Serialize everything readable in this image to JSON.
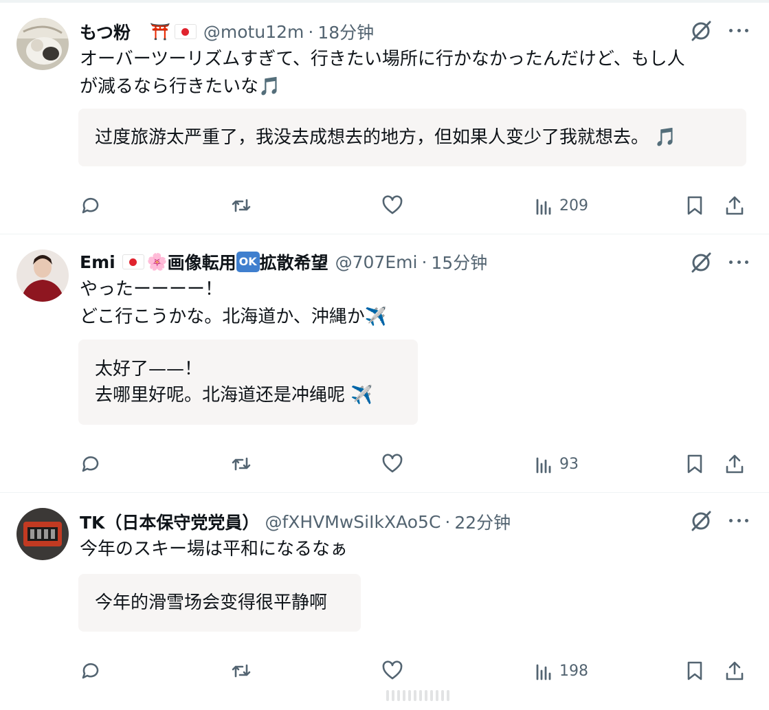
{
  "posts": [
    {
      "name": "もつ粉",
      "badges": [
        "⛩️",
        "flag-japan"
      ],
      "handle": "@motu12m",
      "separator": "·",
      "time": "18分钟",
      "text": "オーバーツーリズムすぎて、行きたい場所に行かなかったんだけど、もし人\nが減るなら行きたいな🎵",
      "translation": "过度旅游太严重了，我没去成想去的地方，但如果人变少了我就想去。 🎵",
      "views": "209"
    },
    {
      "name": "Emi",
      "badges": [
        "flag-japan",
        "🌸"
      ],
      "name_suffix_1": "画像転用",
      "ok_badge": "OK",
      "name_suffix_2": "拡散希望",
      "handle": "@707Emi",
      "separator": "·",
      "time": "15分钟",
      "text": "やったーーーー！\nどこ行こうかな。北海道か、沖縄か✈️",
      "translation": "太好了——！\n去哪里好呢。北海道还是冲绳呢 ✈️",
      "views": "93"
    },
    {
      "name": "TK（日本保守党党員）",
      "handle": "@fXHVMwSiIkXAo5C",
      "separator": "·",
      "time": "22分钟",
      "text": "今年のスキー場は平和になるなぁ",
      "translation": "今年的滑雪场会变得很平静啊",
      "views": "198"
    }
  ],
  "icons": {
    "reply": "reply-icon",
    "repost": "repost-icon",
    "like": "like-icon",
    "views": "views-icon",
    "bookmark": "bookmark-icon",
    "share": "share-icon",
    "grok": "grok-icon",
    "more": "more-icon"
  },
  "colors": {
    "text": "#0f1419",
    "secondary": "#536471",
    "translation_bg": "#f7f5f4",
    "divider": "#eff3f4"
  }
}
